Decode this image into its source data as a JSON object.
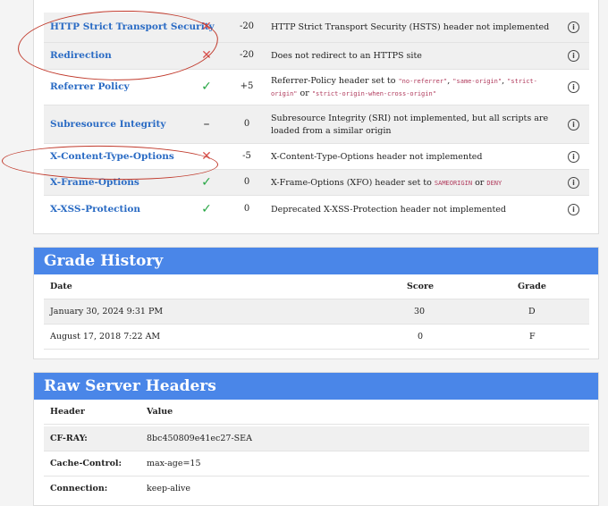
{
  "tests": [
    {
      "name": "HTTP Strict Transport Security",
      "result": "fail",
      "score": "-20",
      "description": "HTTP Strict Transport Security (HSTS) header not implemented"
    },
    {
      "name": "Redirection",
      "result": "fail",
      "score": "-20",
      "description": "Does not redirect to an HTTPS site"
    },
    {
      "name": "Referrer Policy",
      "result": "pass",
      "score": "+5",
      "desc_prefix": "Referrer-Policy header set to",
      "desc_codes": [
        "\"no-referrer\"",
        "\"same-origin\"",
        "\"strict-origin\"",
        "\"strict-origin-when-cross-origin\""
      ],
      "desc_or": "or"
    },
    {
      "name": "Subresource Integrity",
      "result": "neutral",
      "score": "0",
      "description": "Subresource Integrity (SRI) not implemented, but all scripts are loaded from a similar origin"
    },
    {
      "name": "X-Content-Type-Options",
      "result": "fail",
      "score": "-5",
      "description": "X-Content-Type-Options header not implemented"
    },
    {
      "name": "X-Frame-Options",
      "result": "pass",
      "score": "0",
      "desc_prefix": "X-Frame-Options (XFO) header set to",
      "desc_codes": [
        "SAMEORIGIN",
        "DENY"
      ],
      "desc_or": "or"
    },
    {
      "name": "X-XSS-Protection",
      "result": "pass",
      "score": "0",
      "description": "Deprecated X-XSS-Protection header not implemented"
    }
  ],
  "icons": {
    "fail": "✕",
    "pass": "✓",
    "neutral": "–",
    "info": "i"
  },
  "grade_history": {
    "title": "Grade History",
    "columns": {
      "date": "Date",
      "score": "Score",
      "grade": "Grade"
    },
    "rows": [
      {
        "date": "January 30, 2024 9:31 PM",
        "score": "30",
        "grade": "D"
      },
      {
        "date": "August 17, 2018 7:22 AM",
        "score": "0",
        "grade": "F"
      }
    ]
  },
  "raw_headers": {
    "title": "Raw Server Headers",
    "columns": {
      "header": "Header",
      "value": "Value"
    },
    "rows": [
      {
        "header": "CF-RAY:",
        "value": "8bc450809e41ec27-SEA"
      },
      {
        "header": "Cache-Control:",
        "value": "max-age=15"
      },
      {
        "header": "Connection:",
        "value": "keep-alive"
      }
    ]
  },
  "colors": {
    "accent": "#4a86e8",
    "fail": "#d9534f",
    "pass": "#28a745",
    "link": "#2a6bc4",
    "annotation": "#c0392b"
  }
}
